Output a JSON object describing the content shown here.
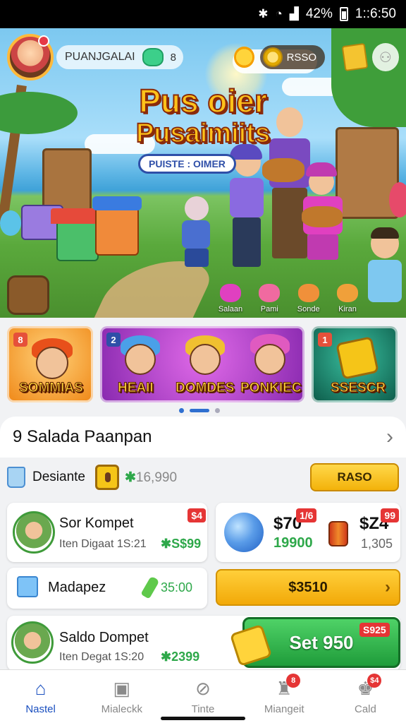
{
  "status_bar": {
    "battery": "42%",
    "time": "1::6:50"
  },
  "hero": {
    "player_name": "PUANJGALAI",
    "gem_count": "8",
    "coin_label": "RSSO",
    "title_line1": "Pus oier",
    "title_line2": "Pusaimiits",
    "subtitle": "PUISTE : OIMER",
    "mini_chars": [
      "Salaan",
      "Pami",
      "Sonde",
      "Kiran"
    ]
  },
  "carousel": {
    "cards": [
      {
        "badge": "8",
        "label": "SOMMIAS",
        "color": "#f5a623"
      },
      {
        "badge": "2",
        "labels": [
          "HEAII",
          "DOMDES",
          "PONKIEC"
        ],
        "color": "#b24ac9"
      },
      {
        "badge": "1",
        "label": "SSESCR",
        "color": "#1a8c6d"
      }
    ]
  },
  "panel": {
    "title": "9 Salada Paanpan",
    "balance_row": {
      "label": "Desiante",
      "amount": "16,990",
      "button": "RASO"
    },
    "item1": {
      "title": "Sor Kompet",
      "sub": "Iten Digaat 1S:21",
      "price": "S$99",
      "tag": "$4"
    },
    "item2": {
      "price_a": "$70",
      "tag_a": "1/6",
      "green_value": "19900",
      "price_b": "$Z4",
      "tag_b": "99",
      "grey_value": "1,305"
    },
    "item3": {
      "title": "Madapez",
      "price": "35:00",
      "button": "$3510"
    },
    "item4": {
      "title": "Saldo Dompet",
      "sub": "Iten Degat 1S:20",
      "price": "2399",
      "button": "Set 950",
      "tag": "S925"
    }
  },
  "nav": {
    "items": [
      {
        "label": "Nastel",
        "icon": "home-icon",
        "active": true
      },
      {
        "label": "Mialeckk",
        "icon": "card-icon"
      },
      {
        "label": "Tinte",
        "icon": "compass-icon"
      },
      {
        "label": "Miangeit",
        "icon": "trophy-icon",
        "badge": "8"
      },
      {
        "label": "Cald",
        "icon": "gift-box-icon",
        "badge": "$4"
      }
    ]
  },
  "colors": {
    "accent": "#1a4fbf",
    "gold": "#f3b20a",
    "green": "#2ea84a",
    "red": "#e53535"
  }
}
